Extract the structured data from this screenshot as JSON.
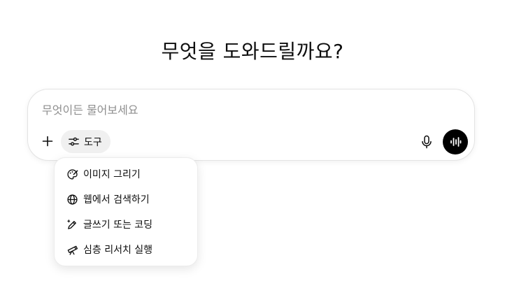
{
  "heading": "무엇을 도와드릴까요?",
  "composer": {
    "placeholder": "무엇이든 물어보세요",
    "value": "",
    "plus_icon": "plus-icon",
    "tools_label": "도구",
    "tools_icon": "sliders-icon",
    "mic_icon": "microphone-icon",
    "voice_icon": "voice-waveform-icon"
  },
  "tools_menu": {
    "items": [
      {
        "label": "이미지 그리기",
        "icon": "palette-icon"
      },
      {
        "label": "웹에서 검색하기",
        "icon": "globe-icon"
      },
      {
        "label": "글쓰기 또는 코딩",
        "icon": "pen-sparkle-icon"
      },
      {
        "label": "심층 리서치 실행",
        "icon": "telescope-icon"
      }
    ]
  },
  "colors": {
    "text": "#0d0d0d",
    "placeholder": "#8f8f8f",
    "tools_chip_bg": "#f0f0f0",
    "voice_button_bg": "#000000",
    "border": "#e3e3e3"
  }
}
